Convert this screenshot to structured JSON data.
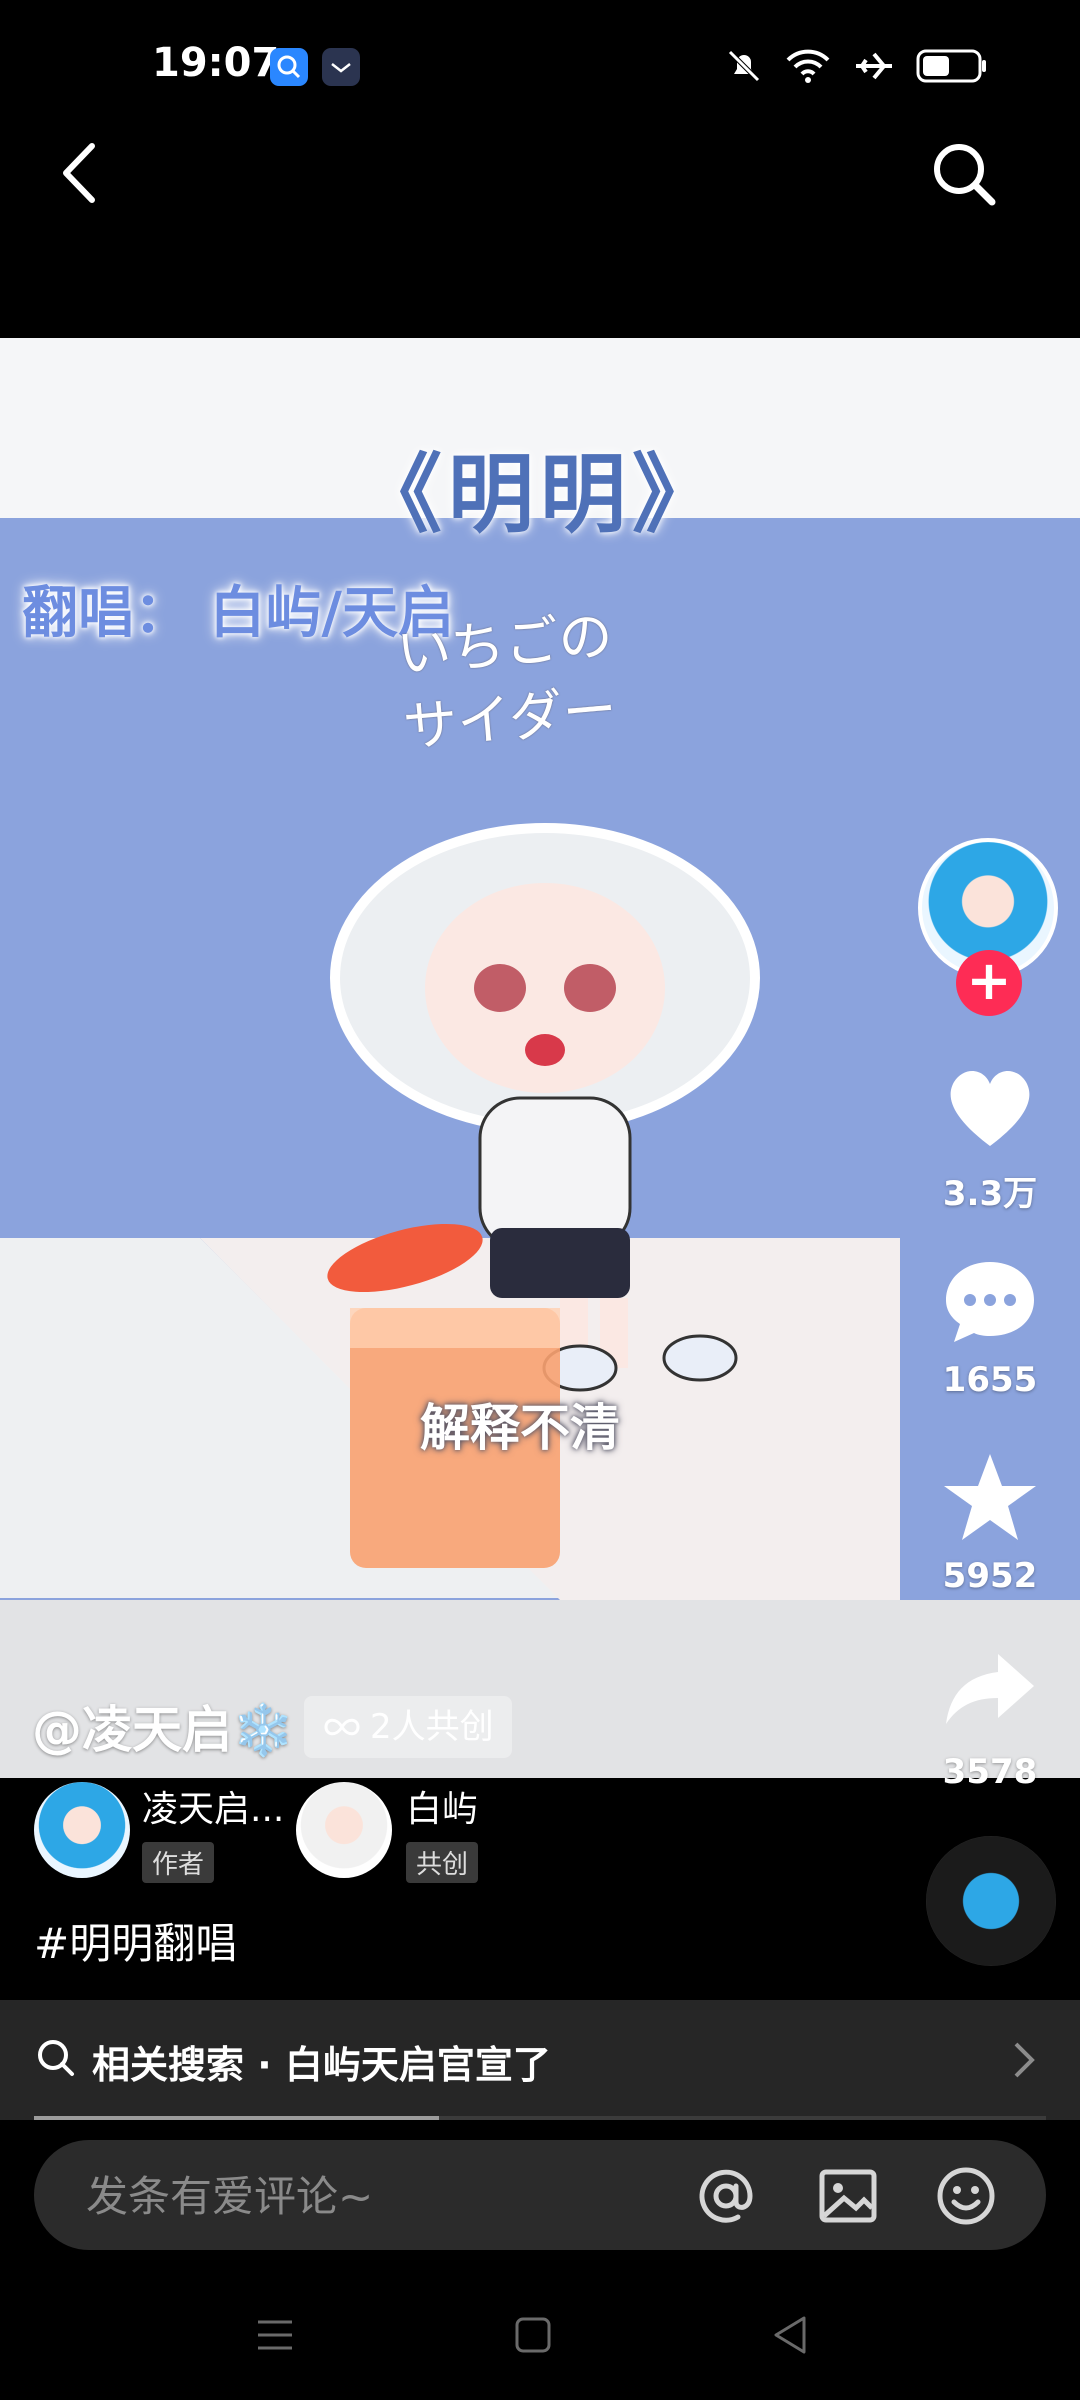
{
  "status_bar": {
    "time": "19:07",
    "icons": [
      "search-app-icon",
      "mail-app-icon",
      "mute-icon",
      "wifi-icon",
      "airplane-icon",
      "battery-icon"
    ]
  },
  "nav": {
    "back_icon": "back-icon",
    "search_icon": "search-icon"
  },
  "video": {
    "title": "《明明》",
    "credit": "翻唱： 白屿/天启",
    "jp_text_line1": "いちごの",
    "jp_text_line2": "サイダー",
    "caption": "解释不清"
  },
  "actions": {
    "likes": "3.3万",
    "comments": "1655",
    "favorites": "5952",
    "shares": "3578",
    "follow_color": "#fe2c55"
  },
  "author": {
    "handle": "@凌天启❄️",
    "cocreate_label": "2人共创"
  },
  "creators": [
    {
      "name": "凌天启...",
      "role": "作者"
    },
    {
      "name": "白屿",
      "role": "共创"
    }
  ],
  "hashtag": "#明明翻唱",
  "related_search": {
    "label": "相关搜索 · 白屿天启官宣了",
    "progress": 0.4
  },
  "comment": {
    "placeholder": "发条有爱评论~"
  },
  "system_nav": [
    "menu-icon",
    "home-icon",
    "back-triangle-icon"
  ]
}
